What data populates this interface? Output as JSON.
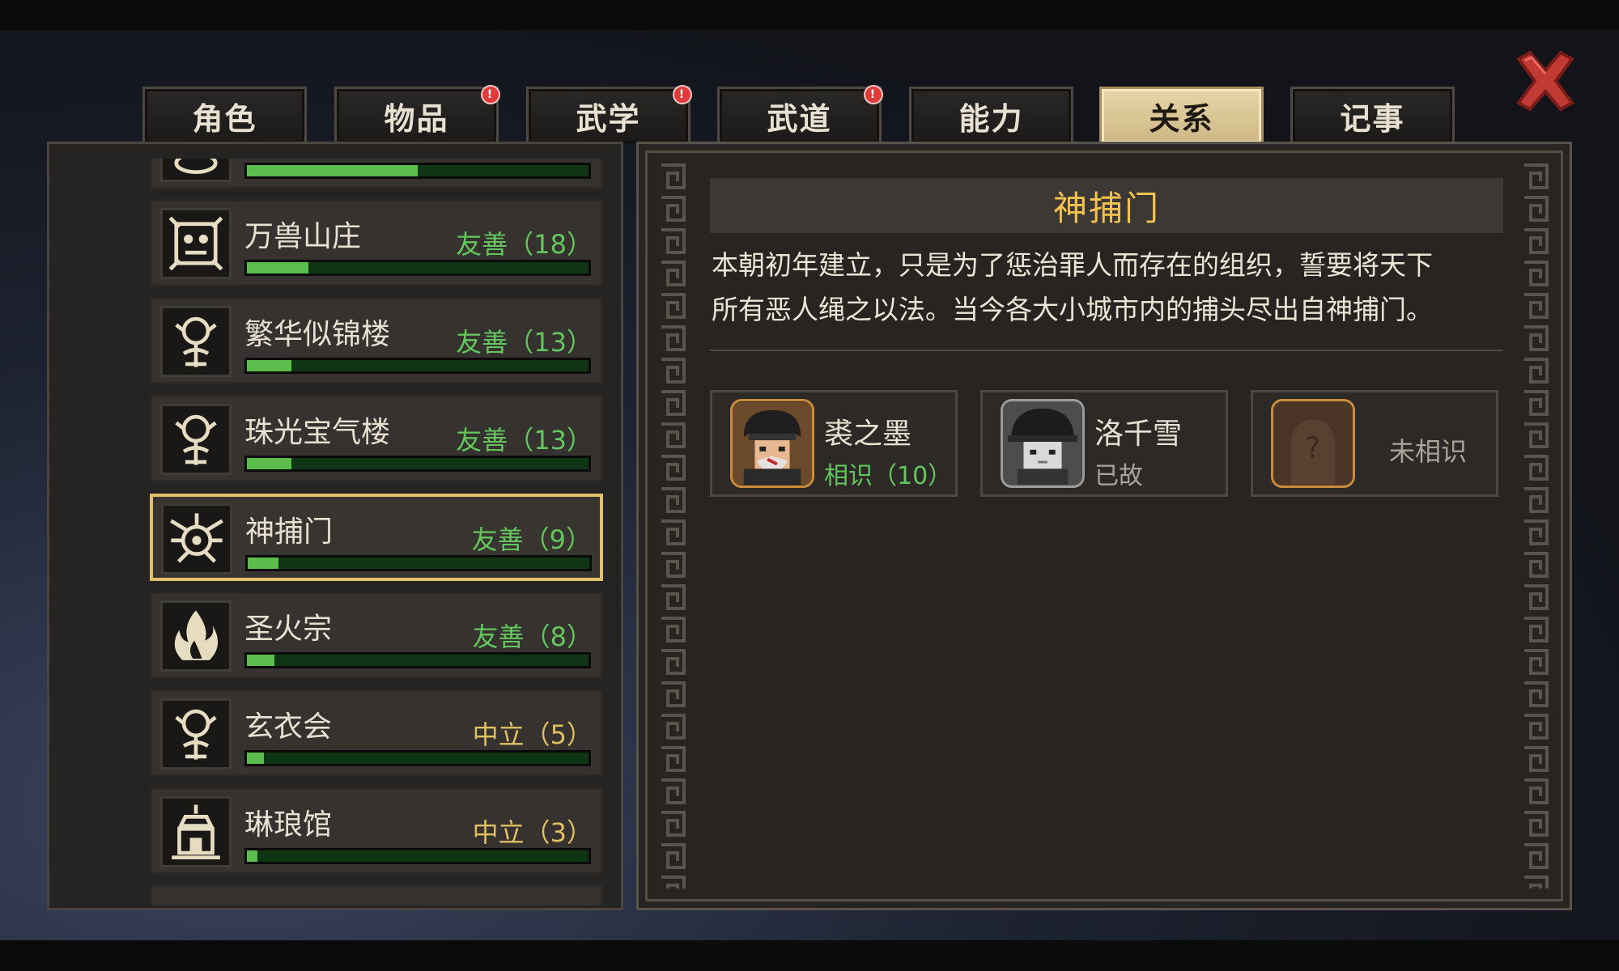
{
  "tabs": [
    {
      "label": "角色",
      "badge": false
    },
    {
      "label": "物品",
      "badge": true
    },
    {
      "label": "武学",
      "badge": true
    },
    {
      "label": "武道",
      "badge": true
    },
    {
      "label": "能力",
      "badge": false
    },
    {
      "label": "关系",
      "badge": false,
      "active": true
    },
    {
      "label": "记事",
      "badge": false
    }
  ],
  "badge_symbol": "!",
  "close_icon": "close-x-icon",
  "factions": [
    {
      "name": "",
      "status": "",
      "progress": 0.5,
      "type": "friendly",
      "emblem": "lotus-emblem-icon"
    },
    {
      "name": "万兽山庄",
      "status": "友善（18）",
      "progress": 0.18,
      "type": "friendly",
      "emblem": "beast-skull-emblem-icon"
    },
    {
      "name": "繁华似锦楼",
      "status": "友善（13）",
      "progress": 0.13,
      "type": "friendly",
      "emblem": "ornate-tower-emblem-icon"
    },
    {
      "name": "珠光宝气楼",
      "status": "友善（13）",
      "progress": 0.13,
      "type": "friendly",
      "emblem": "ornate-tower-emblem-icon"
    },
    {
      "name": "神捕门",
      "status": "友善（9）",
      "progress": 0.09,
      "type": "friendly",
      "emblem": "demon-mask-emblem-icon",
      "selected": true
    },
    {
      "name": "圣火宗",
      "status": "友善（8）",
      "progress": 0.08,
      "type": "friendly",
      "emblem": "flame-emblem-icon"
    },
    {
      "name": "玄衣会",
      "status": "中立（5）",
      "progress": 0.05,
      "type": "neutral",
      "emblem": "ornate-tower-emblem-icon"
    },
    {
      "name": "琳琅馆",
      "status": "中立（3）",
      "progress": 0.03,
      "type": "neutral",
      "emblem": "palace-emblem-icon"
    }
  ],
  "detail": {
    "title": "神捕门",
    "desc_line1": "本朝初年建立，只是为了惩治罪人而存在的组织，誓要将天下",
    "desc_line2": "所有恶人绳之以法。当今各大小城市内的捕头尽出自神捕门。",
    "members": [
      {
        "name": "裘之墨",
        "status": "相识（10）",
        "state": "known",
        "portrait": "helmeted-man-portrait"
      },
      {
        "name": "洛千雪",
        "status": "已故",
        "state": "deceased",
        "portrait": "hatted-woman-portrait"
      },
      {
        "name": "",
        "status": "未相识",
        "state": "unknown",
        "portrait": "unknown-question-portrait",
        "mark": "?"
      }
    ]
  },
  "colors": {
    "friendly": "#63c75e",
    "neutral": "#e0c060",
    "title_gold": "#f2c14e",
    "active_tab": "#e8d6a6",
    "close_red": "#c23a34"
  }
}
